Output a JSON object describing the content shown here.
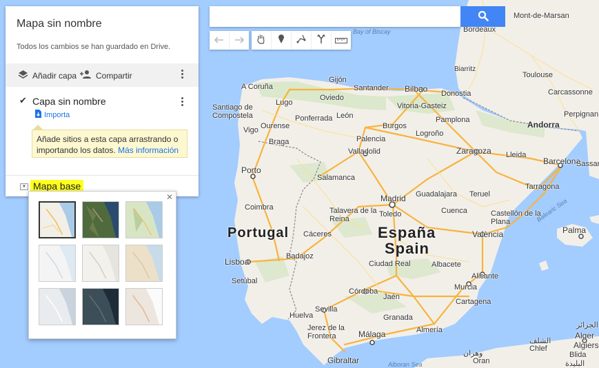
{
  "panel": {
    "title": "Mapa sin nombre",
    "save_status": "Todos los cambios se han guardado en Drive.",
    "add_layer_label": "Añadir capa",
    "share_label": "Compartir",
    "layer": {
      "name": "Capa sin nombre",
      "import_label": "Importa",
      "tip_text": "Añade sitios a esta capa arrastrando o importando los datos.",
      "tip_link": "Más información"
    },
    "basemap_label": "Mapa base"
  },
  "search": {
    "placeholder": "",
    "value": ""
  },
  "icons": {
    "add_layer": "layers-icon",
    "share": "add-person-icon",
    "more": "more-vert-icon",
    "import": "import-icon",
    "search": "search-icon",
    "undo": "undo-icon",
    "redo": "redo-icon",
    "pan": "hand-icon",
    "marker": "marker-icon",
    "draw_line": "polyline-icon",
    "directions": "directions-icon",
    "measure": "ruler-icon",
    "close": "close-icon"
  },
  "colors": {
    "search_button": "#4285f4",
    "link": "#1a73e8",
    "highlight": "#ffff20",
    "tip_bg": "#fef8d0",
    "sea": "#a3ccff",
    "land": "#f2efe9"
  },
  "basemaps": [
    "map",
    "satellite",
    "terrain",
    "light-political",
    "mono-city",
    "simple-atlas",
    "light-landmass",
    "dark-landmass",
    "whitewater"
  ],
  "map": {
    "countries": [
      "Portugal",
      "España",
      "Spain"
    ],
    "water": [
      "Bay of Biscay",
      "Balearic Sea",
      "Alboran Sea"
    ],
    "cities": [
      "Bordeaux",
      "Mont-de-Marsan",
      "Biarritz",
      "Toulouse",
      "Carcassonne",
      "Perpignan",
      "Andorra",
      "Gijón",
      "A Coruña",
      "Santander",
      "Bilbao",
      "Donostia",
      "Oviedo",
      "Lugo",
      "Santiago de Compostela",
      "Vitoria-Gasteiz",
      "Pamplona",
      "Ponferrada",
      "León",
      "Burgos",
      "Logroño",
      "Ourense",
      "Vigo",
      "Braga",
      "Palencia",
      "Valladolid",
      "Zaragoza",
      "Barcelona",
      "Lleida",
      "Tarragona",
      "Porto",
      "Salamanca",
      "Madrid",
      "Guadalajara",
      "Teruel",
      "Castellón de la Plana",
      "Coimbra",
      "Talavera de la Reina",
      "Toledo",
      "Cuenca",
      "Cáceres",
      "València",
      "Palma",
      "Lisboa",
      "Badajoz",
      "Ciudad Real",
      "Albacete",
      "Setúbal",
      "Alicante",
      "Córdoba",
      "Murcia",
      "Jaén",
      "Cartagena",
      "Sevilla",
      "Granada",
      "Huelva",
      "Almería",
      "Málaga",
      "Jerez de la Frontera",
      "Gibraltar",
      "Sassari",
      "Alger",
      "Algiers",
      "Chlef",
      "Blida",
      "Oran",
      "الجزائر",
      "الشلف",
      "البليدة",
      "وهران"
    ]
  }
}
